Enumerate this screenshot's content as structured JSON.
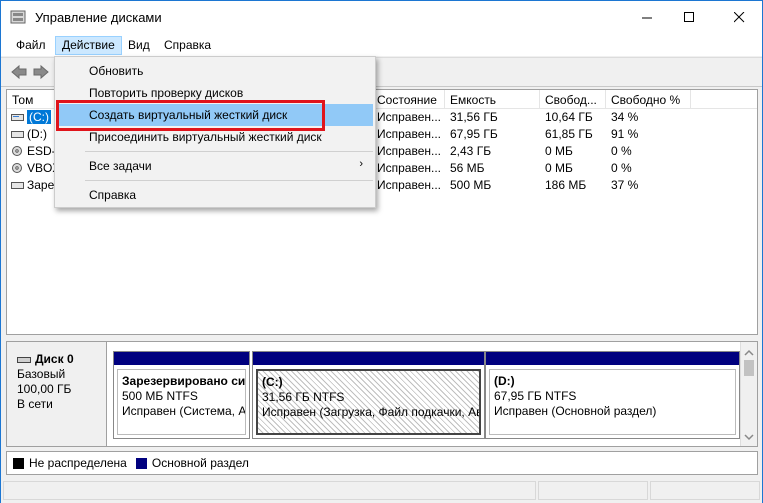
{
  "window": {
    "title": "Управление дисками"
  },
  "menu": {
    "file": "Файл",
    "action": "Действие",
    "view": "Вид",
    "help": "Справка"
  },
  "toolbar": {
    "back_icon": "arrow-left-icon",
    "forward_icon": "arrow-right-icon"
  },
  "columns": {
    "volume": "Том",
    "status": "Состояние",
    "capacity": "Емкость",
    "free": "Свобод...",
    "free_pct": "Свободно %"
  },
  "volumes": [
    {
      "name": "(C:)",
      "status": "Исправен...",
      "capacity": "31,56 ГБ",
      "free": "10,64 ГБ",
      "free_pct": "34 %"
    },
    {
      "name": "(D:)",
      "status": "Исправен...",
      "capacity": "67,95 ГБ",
      "free": "61,85 ГБ",
      "free_pct": "91 %"
    },
    {
      "name": "ESD-",
      "status": "Исправен...",
      "capacity": "2,43 ГБ",
      "free": "0 МБ",
      "free_pct": "0 %"
    },
    {
      "name": "VBOX",
      "status": "Исправен...",
      "capacity": "56 МБ",
      "free": "0 МБ",
      "free_pct": "0 %"
    },
    {
      "name": "Заре",
      "status": "Исправен...",
      "capacity": "500 МБ",
      "free": "186 МБ",
      "free_pct": "37 %"
    }
  ],
  "action_menu": {
    "refresh": "Обновить",
    "rescan": "Повторить проверку дисков",
    "create_vhd": "Создать виртуальный жесткий диск",
    "attach_vhd": "Присоединить виртуальный жесткий диск",
    "all_tasks": "Все задачи",
    "help": "Справка"
  },
  "disk0": {
    "title": "Диск 0",
    "type": "Базовый",
    "size": "100,00 ГБ",
    "state": "В сети",
    "partitions": [
      {
        "name": "Зарезервировано сис",
        "size": "500 МБ NTFS",
        "status": "Исправен (Система, А"
      },
      {
        "name": "(C:)",
        "size": "31,56 ГБ NTFS",
        "status": "Исправен (Загрузка, Файл подкачки, Ав"
      },
      {
        "name": "(D:)",
        "size": "67,95 ГБ NTFS",
        "status": "Исправен (Основной раздел)"
      }
    ]
  },
  "legend": {
    "unallocated": "Не распределена",
    "primary": "Основной раздел"
  },
  "colors": {
    "primary_partition": "#00007f",
    "unallocated": "#000000",
    "highlight": "#91c9f7",
    "red_box": "#e0141b"
  }
}
